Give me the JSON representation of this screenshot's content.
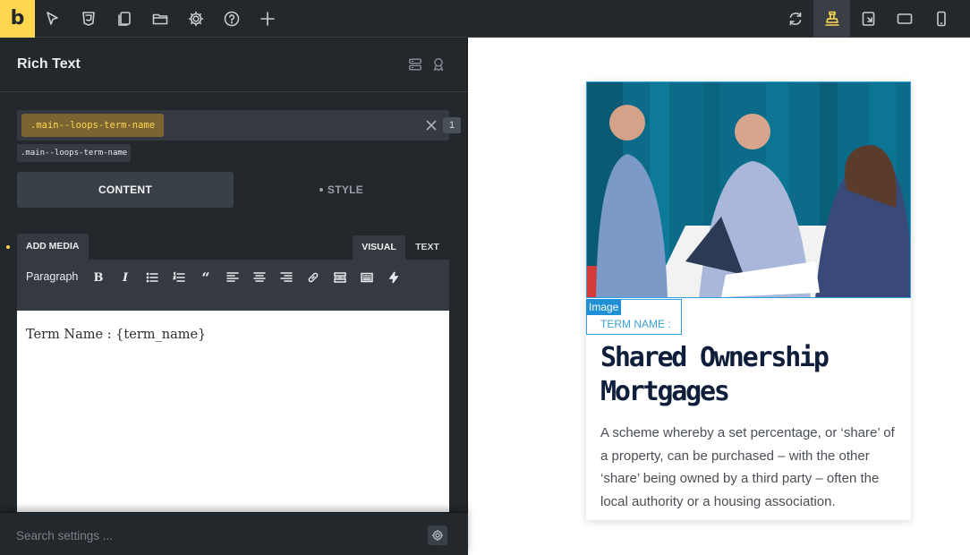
{
  "topbar": {
    "logo": "b",
    "left_icons": [
      "select-icon",
      "css3-icon",
      "pages-icon",
      "folder-icon",
      "settings-icon",
      "help-icon",
      "add-icon"
    ],
    "right_icons": [
      "refresh-icon",
      "desktop-icon",
      "tablet-landscape-icon",
      "tablet-icon",
      "mobile-icon"
    ],
    "active_color": "#ffd64f"
  },
  "panel": {
    "title": "Rich Text",
    "class_chip": ".main--loops-term-name",
    "class_count": "1",
    "class_tag": ".main--loops-term-name",
    "tabs": {
      "content": "CONTENT",
      "style": "STYLE"
    },
    "editor": {
      "add_media": "ADD MEDIA",
      "visual": "VISUAL",
      "text": "TEXT",
      "format": "Paragraph",
      "format_buttons": [
        "bold-icon",
        "italic-icon",
        "bullet-list-icon",
        "numbered-list-icon",
        "blockquote-icon",
        "align-left-icon",
        "align-center-icon",
        "align-right-icon",
        "link-icon",
        "read-more-icon",
        "toolbar-toggle-icon",
        "dynamic-data-icon"
      ],
      "content": "Term Name : {term_name}"
    },
    "search_placeholder": "Search settings ..."
  },
  "canvas": {
    "card": {
      "image_label": "Image",
      "term_label": "TERM NAME :",
      "title": "Shared Ownership Mortgages",
      "description": "A scheme whereby a set percentage, or ‘share’ of a property, can be purchased – with the other ‘share’ being owned by a third party – often the local authority or a housing association."
    }
  }
}
